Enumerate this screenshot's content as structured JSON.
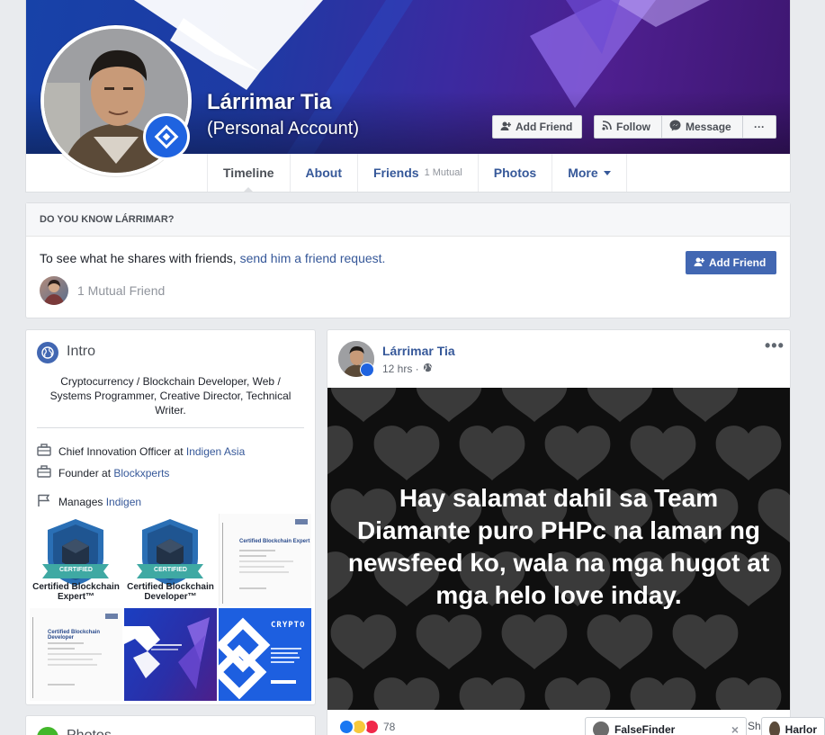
{
  "profile": {
    "name": "Lárrimar Tia",
    "subtitle": "(Personal Account)"
  },
  "cover_actions": {
    "add_friend": "Add Friend",
    "follow": "Follow",
    "message": "Message",
    "more": "···"
  },
  "tabs": [
    {
      "label": "Timeline"
    },
    {
      "label": "About"
    },
    {
      "label": "Friends",
      "sub": "1 Mutual"
    },
    {
      "label": "Photos"
    },
    {
      "label": "More"
    }
  ],
  "know": {
    "header": "DO YOU KNOW LÁRRIMAR?",
    "text": "To see what he shares with friends, ",
    "link": "send him a friend request.",
    "button": "Add Friend",
    "mutual": "1 Mutual Friend"
  },
  "intro": {
    "title": "Intro",
    "bio": "Cryptocurrency / Blockchain Developer, Web / Systems Programmer, Creative Director, Technical Writer.",
    "job1_prefix": "Chief Innovation Officer at ",
    "job1_link": "Indigen Asia",
    "job2_prefix": "Founder at ",
    "job2_link": "Blockxperts",
    "manages_prefix": "Manages ",
    "manages_link": "Indigen",
    "certs": {
      "c1": "Certified Blockchain Expert™",
      "c2": "Certified Blockchain Developer™",
      "c1_badge": "CERTIFIED",
      "c2_badge": "CERTIFIED",
      "doc1_title": "Certified Blockchain Expert",
      "doc2_title": "Certified Blockchain Developer",
      "crypto": "CRYPTO"
    }
  },
  "photos": {
    "title": "Photos"
  },
  "post": {
    "author": "Lárrimar Tia",
    "time": "12 hrs ·",
    "text": "Hay salamat dahil sa Team Diamante puro PHPc na laman ng newsfeed ko, wala na mga hugot at mga helo love inday.",
    "reactions": "78",
    "share_partial": "Sh"
  },
  "chats": [
    {
      "name": "FalseFinder"
    },
    {
      "name": "Harlor"
    }
  ],
  "colors": {
    "link": "#365899",
    "primary": "#4267b2",
    "page_bg": "#e9ebee"
  }
}
